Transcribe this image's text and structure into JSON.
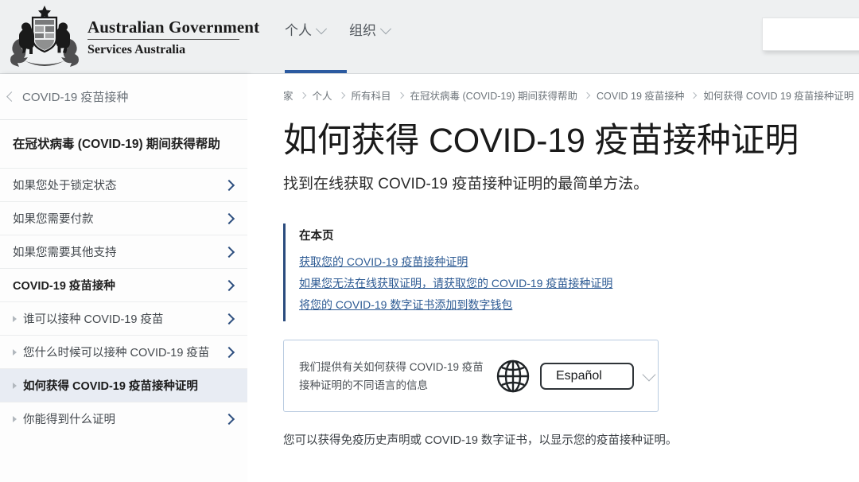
{
  "header": {
    "brand": {
      "line1": "Australian Government",
      "line2": "Services Australia",
      "crest_icon": "commonwealth-coat-of-arms"
    },
    "nav": [
      {
        "label": "个人",
        "caret_icon": "chevron-down-icon",
        "active": true
      },
      {
        "label": "组织",
        "caret_icon": "chevron-down-icon",
        "active": false
      }
    ],
    "accent_color": "#2b5aa0",
    "background_color": "#eef0f1"
  },
  "sidebar": {
    "back_label": "COVID-19 疫苗接种",
    "back_icon": "chevron-left-icon",
    "section_title": "在冠状病毒 (COVID-19) 期间获得帮助",
    "items": [
      {
        "label": "如果您处于锁定状态",
        "level": 1,
        "bold": false,
        "selected": false,
        "chevron": true,
        "bullet": false
      },
      {
        "label": "如果您需要付款",
        "level": 1,
        "bold": false,
        "selected": false,
        "chevron": true,
        "bullet": false
      },
      {
        "label": "如果您需要其他支持",
        "level": 1,
        "bold": false,
        "selected": false,
        "chevron": true,
        "bullet": false
      },
      {
        "label": "COVID-19 疫苗接种",
        "level": 1,
        "bold": true,
        "selected": false,
        "chevron": true,
        "bullet": false
      },
      {
        "label": "谁可以接种 COVID-19 疫苗",
        "level": 2,
        "bold": false,
        "selected": false,
        "chevron": true,
        "bullet": true
      },
      {
        "label": "您什么时候可以接种 COVID-19 疫苗",
        "level": 2,
        "bold": false,
        "selected": false,
        "chevron": true,
        "bullet": true
      },
      {
        "label": "如何获得 COVID-19 疫苗接种证明",
        "level": 2,
        "bold": true,
        "selected": true,
        "chevron": false,
        "bullet": true
      },
      {
        "label": "你能得到什么证明",
        "level": 2,
        "bold": false,
        "selected": false,
        "chevron": true,
        "bullet": true
      }
    ],
    "selected_background": "#e8ecf3"
  },
  "content": {
    "breadcrumb": [
      "家",
      "个人",
      "所有科目",
      "在冠状病毒 (COVID-19) 期间获得帮助",
      "COVID 19 疫苗接种",
      "如何获得 COVID 19 疫苗接种证明"
    ],
    "title": "如何获得 COVID-19 疫苗接种证明",
    "subtitle": "找到在线获取 COVID-19 疫苗接种证明的最简单方法。",
    "on_this_page": {
      "heading": "在本页",
      "border_color": "#2b4c7e",
      "links": [
        "获取您的 COVID-19 疫苗接种证明",
        "如果您无法在线获取证明，请获取您的 COVID-19 疫苗接种证明",
        "将您的 COVID-19 数字证书添加到数字钱包"
      ]
    },
    "language_box": {
      "text": "我们提供有关如何获得 COVID-19 疫苗接种证明的不同语言的信息",
      "globe_icon": "globe-icon",
      "selected_language": "Español",
      "caret_icon": "chevron-down-icon"
    },
    "paragraph": "您可以获得免疫历史声明或 COVID-19 数字证书，以显示您的疫苗接种证明。"
  }
}
